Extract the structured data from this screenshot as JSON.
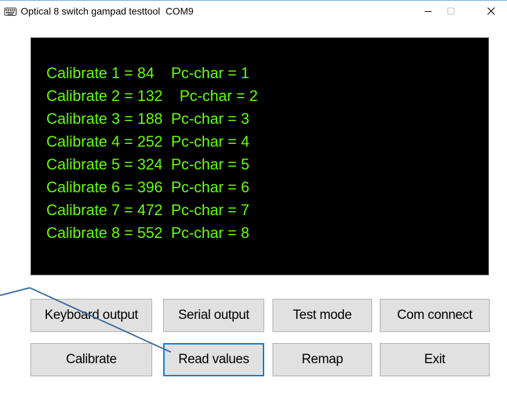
{
  "window": {
    "title": "Optical 8 switch gampad testtool  COM9"
  },
  "console": {
    "lines": [
      "Calibrate 1 = 84    Pc-char = 1",
      "Calibrate 2 = 132    Pc-char = 2",
      "Calibrate 3 = 188  Pc-char = 3",
      "Calibrate 4 = 252  Pc-char = 4",
      "Calibrate 5 = 324  Pc-char = 5",
      "Calibrate 6 = 396  Pc-char = 6",
      "Calibrate 7 = 472  Pc-char = 7",
      "Calibrate 8 = 552  Pc-char = 8"
    ],
    "text_color": "#66ff00",
    "background": "#000000"
  },
  "buttons": {
    "keyboard_output": "Keyboard output",
    "serial_output": "Serial output",
    "test_mode": "Test mode",
    "com_connect": "Com connect",
    "calibrate": "Calibrate",
    "read_values": "Read values",
    "remap": "Remap",
    "exit": "Exit"
  },
  "icons": {
    "app": "keyboard-icon",
    "minimize": "minimize-icon",
    "maximize": "maximize-icon",
    "close": "close-icon"
  },
  "colors": {
    "focus": "#0078d7",
    "button_face": "#e1e1e1",
    "annotation_line": "#3b6a9a"
  }
}
